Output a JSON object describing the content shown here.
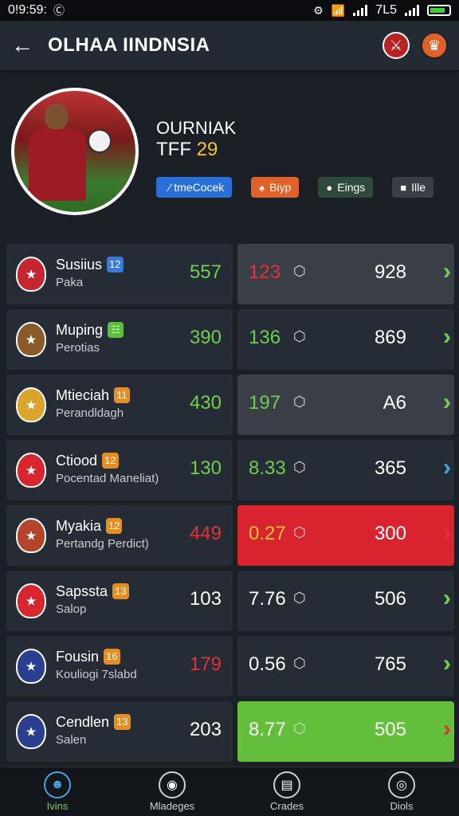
{
  "status": {
    "time": "0!9:59:",
    "network": "7L5"
  },
  "header": {
    "title": "OLHAA IINDNSIA",
    "back_icon": "arrow-left-icon",
    "crest1": "club-crest-icon",
    "crest2": "club-crest-icon"
  },
  "profile": {
    "name": "OURNIAK",
    "stat_label": "TFF",
    "stat_value": "29",
    "tags": [
      {
        "label": "∕ tmeCocek",
        "color": "#2a6fd6",
        "icon": ""
      },
      {
        "label": "Biyp",
        "color": "#e0622a",
        "icon": "♠"
      },
      {
        "label": "Eings",
        "color": "#2f4a3a",
        "icon": "●"
      },
      {
        "label": "Ille",
        "color": "#3a3f47",
        "icon": "■"
      }
    ]
  },
  "rows": [
    {
      "name": "Susiius",
      "badge": "12",
      "badge_color": "#3a7bd5",
      "sub": "Paka",
      "left_value": "557",
      "left_color": "#6fcf4a",
      "mid_value": "123",
      "mid_color": "#e0333c",
      "right_value": "928",
      "chev_color": "#6fcf4a",
      "card": "gray",
      "crest_color": "#c62630"
    },
    {
      "name": "Muping",
      "badge": "☷",
      "badge_color": "#5bbf3a",
      "sub": "Perotias",
      "left_value": "390",
      "left_color": "#6fcf4a",
      "mid_value": "136",
      "mid_color": "#6fcf4a",
      "right_value": "869",
      "chev_color": "#6fcf4a",
      "card": "dark",
      "crest_color": "#8b5a2b"
    },
    {
      "name": "Mtieciah",
      "badge": "11",
      "badge_color": "#e58e26",
      "sub": "Perandldagh",
      "left_value": "430",
      "left_color": "#6fcf4a",
      "mid_value": "197",
      "mid_color": "#6fcf4a",
      "right_value": "A6",
      "chev_color": "#6fcf4a",
      "card": "gray",
      "crest_color": "#d9a52a"
    },
    {
      "name": "Ctiood",
      "badge": "12",
      "badge_color": "#e58e26",
      "sub": "Pocentad Maneliat)",
      "left_value": "130",
      "left_color": "#6fcf4a",
      "mid_value": "8.33",
      "mid_color": "#6fcf4a",
      "right_value": "365",
      "chev_color": "#3aa7e0",
      "card": "dark",
      "crest_color": "#d8262e"
    },
    {
      "name": "Myakia",
      "badge": "12",
      "badge_color": "#e58e26",
      "sub": "Pertandg Perdict)",
      "left_value": "449",
      "left_color": "#e0333c",
      "mid_value": "0.27",
      "mid_color": "#f0c533",
      "right_value": "300",
      "chev_color": "#e0333c",
      "card": "red",
      "crest_color": "#b5452a"
    },
    {
      "name": "Sapssta",
      "badge": "13",
      "badge_color": "#e58e26",
      "sub": "Salop",
      "left_value": "103",
      "left_color": "#ffffff",
      "mid_value": "7.76",
      "mid_color": "#ffffff",
      "right_value": "506",
      "chev_color": "#6fcf4a",
      "card": "dark",
      "crest_color": "#d8262e"
    },
    {
      "name": "Fousin",
      "badge": "16",
      "badge_color": "#e58e26",
      "sub": "Kouliogi 7slabd",
      "left_value": "179",
      "left_color": "#e0333c",
      "mid_value": "0.56",
      "mid_color": "#ffffff",
      "right_value": "765",
      "chev_color": "#6fcf4a",
      "card": "dark",
      "crest_color": "#2c3e8f"
    },
    {
      "name": "Cendlen",
      "badge": "13",
      "badge_color": "#e58e26",
      "sub": "Salen",
      "left_value": "203",
      "left_color": "#ffffff",
      "mid_value": "8.77",
      "mid_color": "#ffffff",
      "right_value": "505",
      "chev_color": "#e0333c",
      "card": "green",
      "crest_color": "#2c3e8f"
    }
  ],
  "nav": [
    {
      "label": "Ivins",
      "icon": "player-icon",
      "active": true
    },
    {
      "label": "Mladeges",
      "icon": "ball-icon",
      "active": false
    },
    {
      "label": "Crades",
      "icon": "chart-icon",
      "active": false
    },
    {
      "label": "Diols",
      "icon": "stats-icon",
      "active": false
    }
  ]
}
